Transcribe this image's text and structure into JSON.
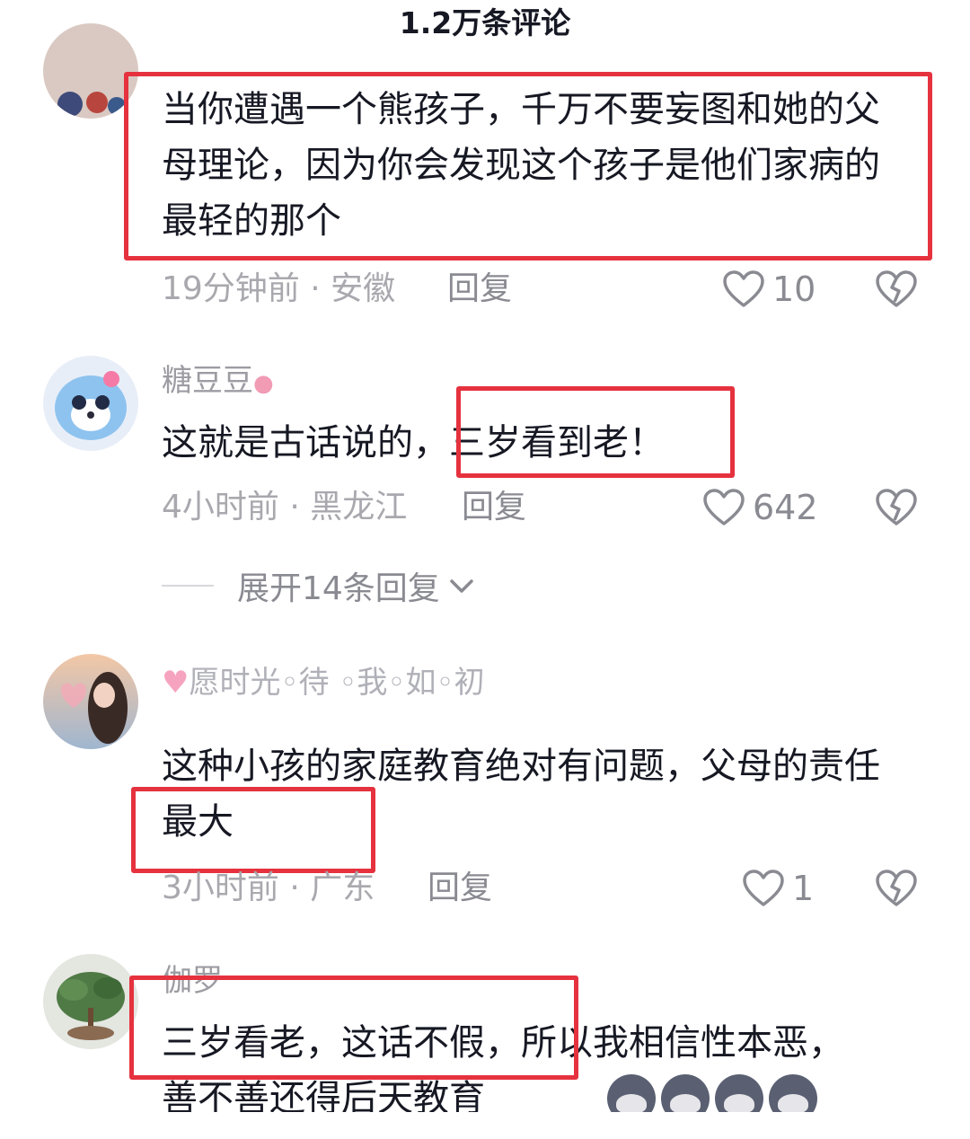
{
  "header": {
    "title": "1.2万条评论"
  },
  "comments": [
    {
      "text": "当你遭遇一个熊孩子，千万不要妄图和她的父母理论，因为你会发现这个孩子是他们家病的最轻的那个",
      "time_location": "19分钟前 · 安徽",
      "reply_label": "回复",
      "likes": "10"
    },
    {
      "username": "糖豆豆",
      "text": "这就是古话说的，三岁看到老！",
      "time_location": "4小时前 · 黑龙江",
      "reply_label": "回复",
      "likes": "642",
      "expand_label": "展开14条回复"
    },
    {
      "username": "愿时光◦待 ◦我◦如◦初",
      "text": "这种小孩的家庭教育绝对有问题，父母的责任最大",
      "time_location": "3小时前 · 广东",
      "reply_label": "回复",
      "likes": "1"
    },
    {
      "username": "伽罗",
      "text": "三岁看老，这话不假，所以我相信性本恶，善不善还得后天教育"
    }
  ],
  "icons": {
    "like": "heart-outline-icon",
    "dislike": "broken-heart-icon",
    "expand": "chevron-down-icon"
  },
  "colors": {
    "highlight_box": "#e5323e",
    "meta_text": "#a8a8ae"
  }
}
